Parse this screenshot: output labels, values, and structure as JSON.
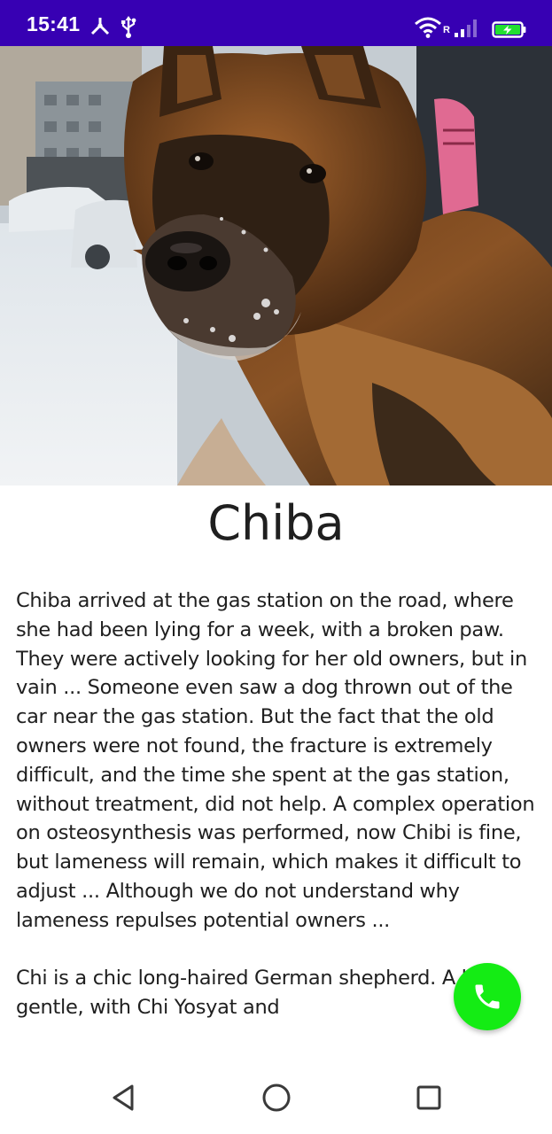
{
  "status_bar": {
    "time": "15:41",
    "background": "#3700b3",
    "icons": [
      "network-share-icon",
      "usb-icon",
      "wifi-icon",
      "roaming-indicator",
      "signal-icon",
      "battery-charging-icon"
    ],
    "roaming_label": "R"
  },
  "hero": {
    "subject": "German shepherd dog in snow"
  },
  "pet": {
    "name": "Chiba",
    "description": "Chiba arrived at the gas station on the road, where she had been lying for a week, with a broken paw. They were actively looking for her old owners, but in vain ... Someone even saw a dog thrown out of the car near the gas station. But the fact that the old owners were not found, the fracture is extremely difficult, and the time she spent at the gas station, without treatment, did not help. A complex operation on osteosynthesis was performed, now Chibi is fine, but lameness will remain, which makes it difficult to adjust ... Although we do not understand why lameness repulses potential owners ...\n\nChi is a chic long-haired German shepherd. A kind, gentle, with Chi Yosyat and"
  },
  "fab": {
    "icon": "phone-icon",
    "color": "#14ec14"
  },
  "nav_bar": {
    "buttons": [
      "back-icon",
      "home-icon",
      "recents-icon"
    ]
  }
}
